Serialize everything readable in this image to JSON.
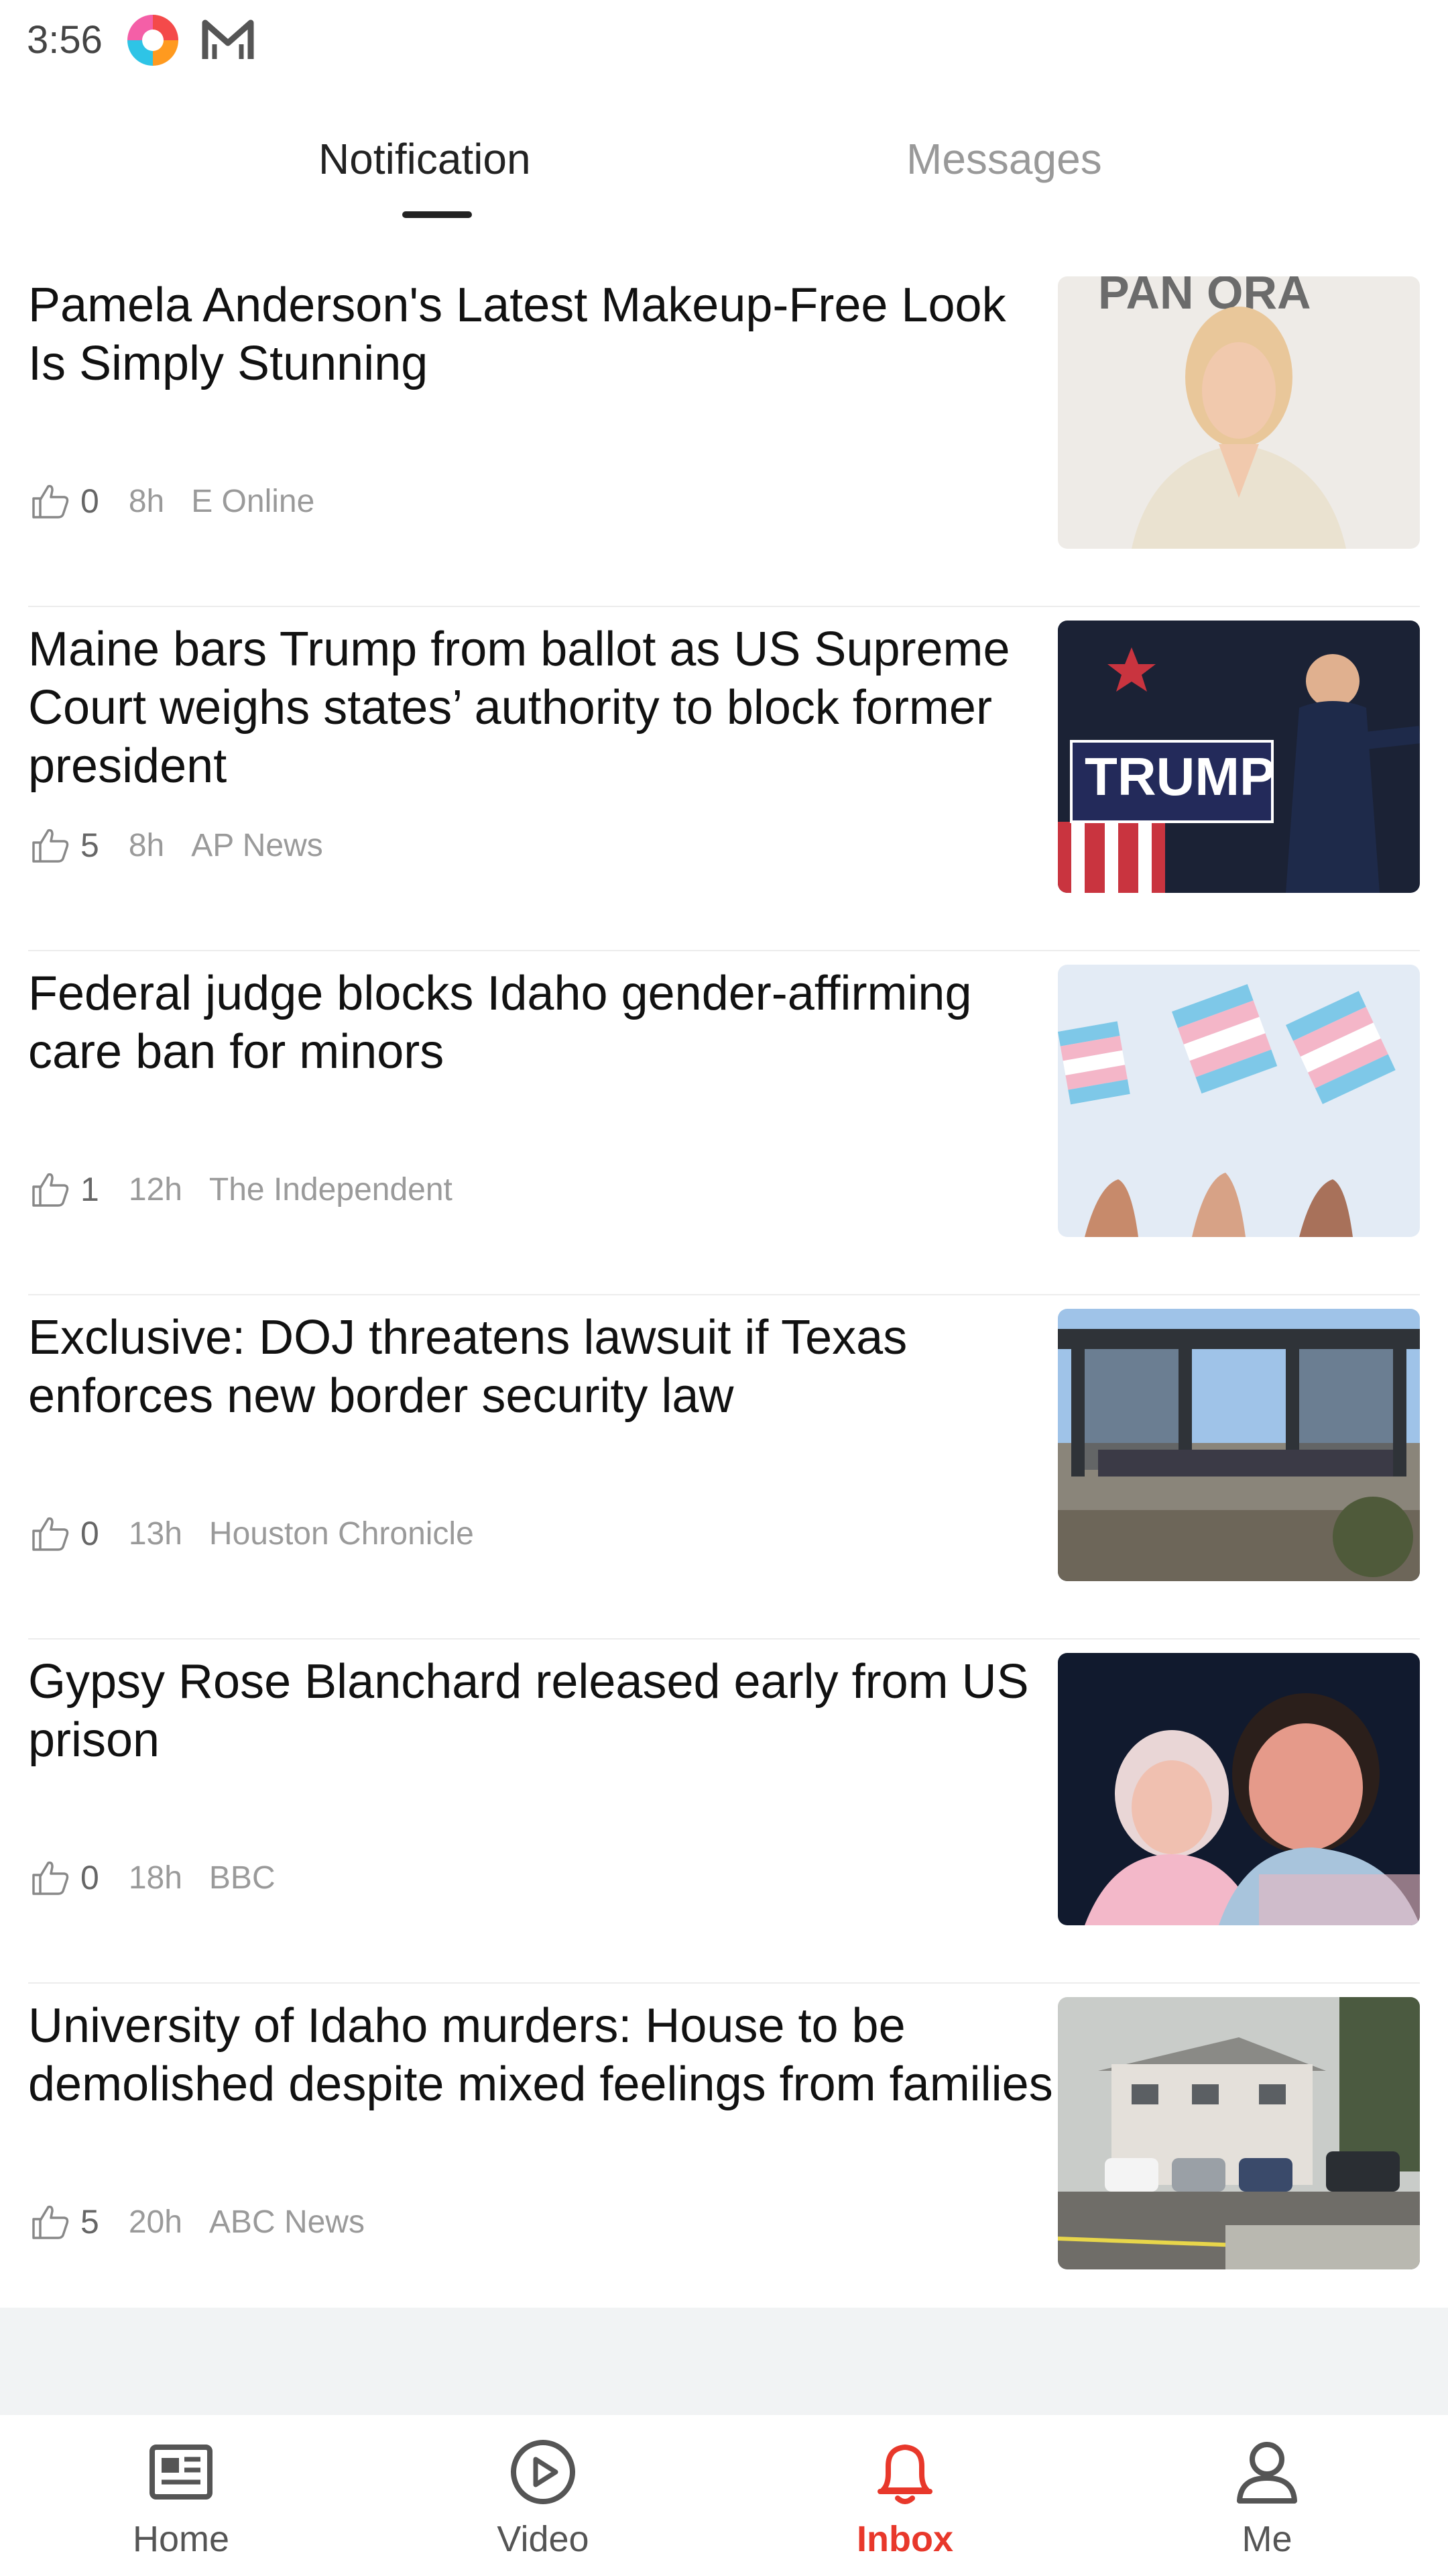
{
  "status_bar": {
    "time": "3:56"
  },
  "tabs": [
    {
      "label": "Notification",
      "active": true
    },
    {
      "label": "Messages",
      "active": false
    }
  ],
  "items": [
    {
      "headline": "Pamela Anderson's Latest Makeup-Free Look Is Simply Stunning",
      "likes": "0",
      "age": "8h",
      "source": "E Online",
      "image": "portrait-woman-white-shirt"
    },
    {
      "headline": "Maine bars Trump from ballot as US Supreme Court weighs states’ authority to block former president",
      "likes": "5",
      "age": "8h",
      "source": "AP News",
      "image": "rally-stage-campaign-sign"
    },
    {
      "headline": "Federal judge blocks Idaho gender-affirming care ban for minors",
      "likes": "1",
      "age": "12h",
      "source": "The Independent",
      "image": "transgender-flags-raised"
    },
    {
      "headline": "Exclusive: DOJ threatens lawsuit if Texas enforces new border security law",
      "likes": "0",
      "age": "13h",
      "source": "Houston Chronicle",
      "image": "border-fence-crowd"
    },
    {
      "headline": "Gypsy Rose Blanchard released early from US prison",
      "likes": "0",
      "age": "18h",
      "source": "BBC",
      "image": "two-people-embracing"
    },
    {
      "headline": "University of Idaho murders: House to be demolished despite mixed feelings from families",
      "likes": "5",
      "age": "20h",
      "source": "ABC News",
      "image": "house-with-cars"
    }
  ],
  "bottom_nav": [
    {
      "label": "Home",
      "icon": "newspaper-icon",
      "active": false
    },
    {
      "label": "Video",
      "icon": "play-circle-icon",
      "active": false
    },
    {
      "label": "Inbox",
      "icon": "bell-icon",
      "active": true
    },
    {
      "label": "Me",
      "icon": "person-icon",
      "active": false
    }
  ],
  "colors": {
    "accent": "#e8382b",
    "muted_text": "#9a9a9a",
    "divider": "#ececec"
  }
}
